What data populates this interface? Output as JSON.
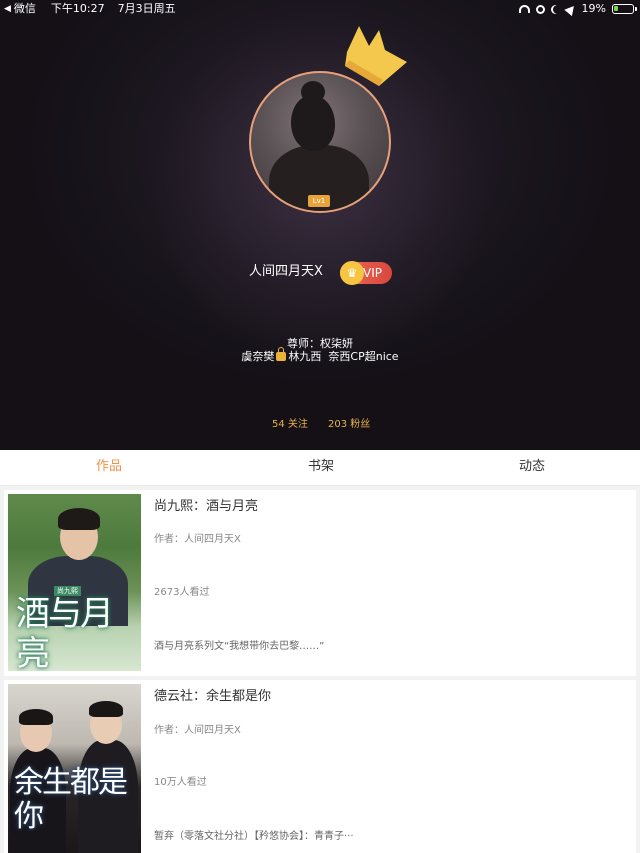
{
  "status_bar": {
    "back_app": "微信",
    "time": "下午10:27",
    "date": "7月3日周五",
    "battery": "19%"
  },
  "profile": {
    "username": "人间四月天X",
    "level_badge": "Lv1",
    "vip_label": "VIP",
    "bio_line1": "尊师：权柒妍",
    "bio_line2_a": "虞奈樊",
    "bio_line2_b": "林九西",
    "bio_line2_c": "奈西CP超nice",
    "follow_count": "54 关注",
    "fans_count": "203 粉丝",
    "colors": {
      "accent": "#f0914a",
      "stats": "#e6b24a",
      "vip": "#d9473d"
    }
  },
  "tabs": [
    {
      "label": "作品",
      "active": true
    },
    {
      "label": "书架",
      "active": false
    },
    {
      "label": "动态",
      "active": false
    }
  ],
  "works": [
    {
      "title": "尚九熙：酒与月亮",
      "author": "作者：人间四月天X",
      "views": "2673人看过",
      "description": "酒与月亮系列文“我想带你去巴黎……”",
      "cover_title": "酒与月亮",
      "cover_subtitle": "尚九熙"
    },
    {
      "title": "德云社：余生都是你",
      "author": "作者：人间四月天X",
      "views": "10万人看过",
      "description": "暂弃（零落文社分社）【矜悠协会】：青青子···",
      "cover_title": "余生都是你"
    }
  ]
}
